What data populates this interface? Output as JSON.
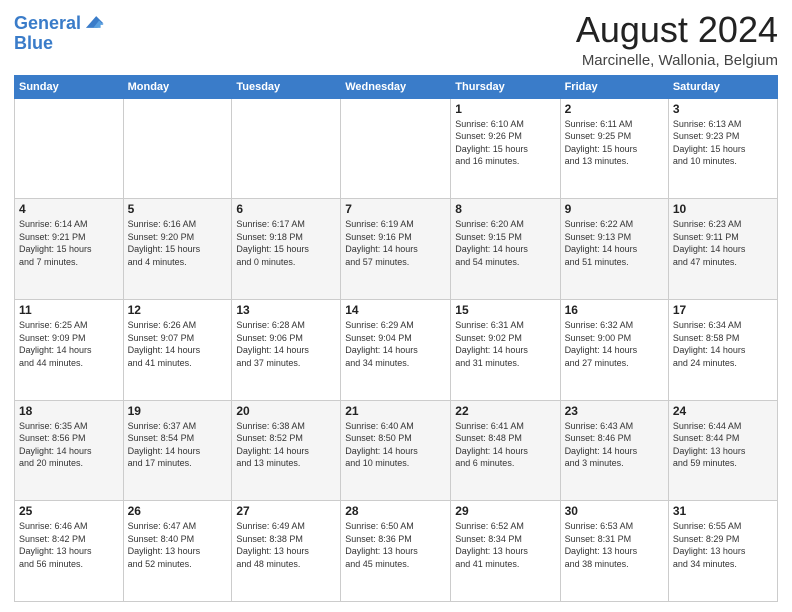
{
  "header": {
    "logo_line1": "General",
    "logo_line2": "Blue",
    "title": "August 2024",
    "subtitle": "Marcinelle, Wallonia, Belgium"
  },
  "weekdays": [
    "Sunday",
    "Monday",
    "Tuesday",
    "Wednesday",
    "Thursday",
    "Friday",
    "Saturday"
  ],
  "weeks": [
    [
      {
        "day": "",
        "info": ""
      },
      {
        "day": "",
        "info": ""
      },
      {
        "day": "",
        "info": ""
      },
      {
        "day": "",
        "info": ""
      },
      {
        "day": "1",
        "info": "Sunrise: 6:10 AM\nSunset: 9:26 PM\nDaylight: 15 hours\nand 16 minutes."
      },
      {
        "day": "2",
        "info": "Sunrise: 6:11 AM\nSunset: 9:25 PM\nDaylight: 15 hours\nand 13 minutes."
      },
      {
        "day": "3",
        "info": "Sunrise: 6:13 AM\nSunset: 9:23 PM\nDaylight: 15 hours\nand 10 minutes."
      }
    ],
    [
      {
        "day": "4",
        "info": "Sunrise: 6:14 AM\nSunset: 9:21 PM\nDaylight: 15 hours\nand 7 minutes."
      },
      {
        "day": "5",
        "info": "Sunrise: 6:16 AM\nSunset: 9:20 PM\nDaylight: 15 hours\nand 4 minutes."
      },
      {
        "day": "6",
        "info": "Sunrise: 6:17 AM\nSunset: 9:18 PM\nDaylight: 15 hours\nand 0 minutes."
      },
      {
        "day": "7",
        "info": "Sunrise: 6:19 AM\nSunset: 9:16 PM\nDaylight: 14 hours\nand 57 minutes."
      },
      {
        "day": "8",
        "info": "Sunrise: 6:20 AM\nSunset: 9:15 PM\nDaylight: 14 hours\nand 54 minutes."
      },
      {
        "day": "9",
        "info": "Sunrise: 6:22 AM\nSunset: 9:13 PM\nDaylight: 14 hours\nand 51 minutes."
      },
      {
        "day": "10",
        "info": "Sunrise: 6:23 AM\nSunset: 9:11 PM\nDaylight: 14 hours\nand 47 minutes."
      }
    ],
    [
      {
        "day": "11",
        "info": "Sunrise: 6:25 AM\nSunset: 9:09 PM\nDaylight: 14 hours\nand 44 minutes."
      },
      {
        "day": "12",
        "info": "Sunrise: 6:26 AM\nSunset: 9:07 PM\nDaylight: 14 hours\nand 41 minutes."
      },
      {
        "day": "13",
        "info": "Sunrise: 6:28 AM\nSunset: 9:06 PM\nDaylight: 14 hours\nand 37 minutes."
      },
      {
        "day": "14",
        "info": "Sunrise: 6:29 AM\nSunset: 9:04 PM\nDaylight: 14 hours\nand 34 minutes."
      },
      {
        "day": "15",
        "info": "Sunrise: 6:31 AM\nSunset: 9:02 PM\nDaylight: 14 hours\nand 31 minutes."
      },
      {
        "day": "16",
        "info": "Sunrise: 6:32 AM\nSunset: 9:00 PM\nDaylight: 14 hours\nand 27 minutes."
      },
      {
        "day": "17",
        "info": "Sunrise: 6:34 AM\nSunset: 8:58 PM\nDaylight: 14 hours\nand 24 minutes."
      }
    ],
    [
      {
        "day": "18",
        "info": "Sunrise: 6:35 AM\nSunset: 8:56 PM\nDaylight: 14 hours\nand 20 minutes."
      },
      {
        "day": "19",
        "info": "Sunrise: 6:37 AM\nSunset: 8:54 PM\nDaylight: 14 hours\nand 17 minutes."
      },
      {
        "day": "20",
        "info": "Sunrise: 6:38 AM\nSunset: 8:52 PM\nDaylight: 14 hours\nand 13 minutes."
      },
      {
        "day": "21",
        "info": "Sunrise: 6:40 AM\nSunset: 8:50 PM\nDaylight: 14 hours\nand 10 minutes."
      },
      {
        "day": "22",
        "info": "Sunrise: 6:41 AM\nSunset: 8:48 PM\nDaylight: 14 hours\nand 6 minutes."
      },
      {
        "day": "23",
        "info": "Sunrise: 6:43 AM\nSunset: 8:46 PM\nDaylight: 14 hours\nand 3 minutes."
      },
      {
        "day": "24",
        "info": "Sunrise: 6:44 AM\nSunset: 8:44 PM\nDaylight: 13 hours\nand 59 minutes."
      }
    ],
    [
      {
        "day": "25",
        "info": "Sunrise: 6:46 AM\nSunset: 8:42 PM\nDaylight: 13 hours\nand 56 minutes."
      },
      {
        "day": "26",
        "info": "Sunrise: 6:47 AM\nSunset: 8:40 PM\nDaylight: 13 hours\nand 52 minutes."
      },
      {
        "day": "27",
        "info": "Sunrise: 6:49 AM\nSunset: 8:38 PM\nDaylight: 13 hours\nand 48 minutes."
      },
      {
        "day": "28",
        "info": "Sunrise: 6:50 AM\nSunset: 8:36 PM\nDaylight: 13 hours\nand 45 minutes."
      },
      {
        "day": "29",
        "info": "Sunrise: 6:52 AM\nSunset: 8:34 PM\nDaylight: 13 hours\nand 41 minutes."
      },
      {
        "day": "30",
        "info": "Sunrise: 6:53 AM\nSunset: 8:31 PM\nDaylight: 13 hours\nand 38 minutes."
      },
      {
        "day": "31",
        "info": "Sunrise: 6:55 AM\nSunset: 8:29 PM\nDaylight: 13 hours\nand 34 minutes."
      }
    ]
  ]
}
